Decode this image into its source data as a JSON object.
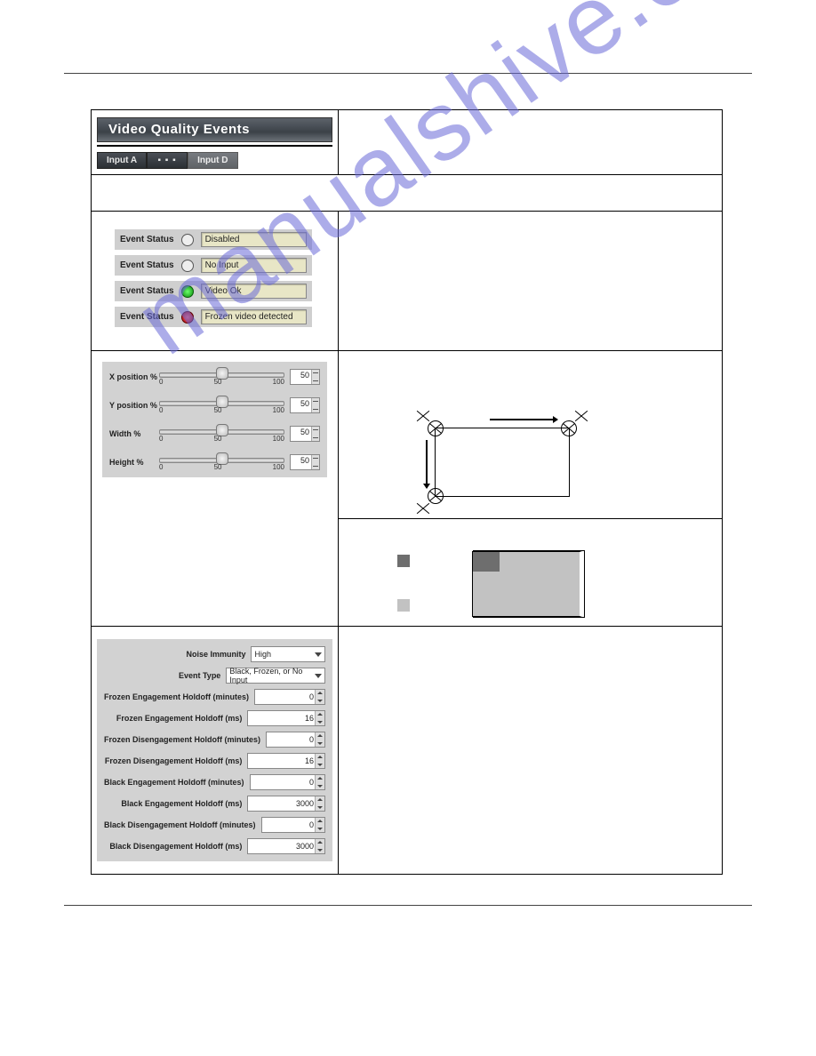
{
  "watermark": "manualshive.com",
  "header": {
    "title": "Video Quality Events",
    "tabs": {
      "a": "Input A",
      "dots": "▪ ▪ ▪",
      "d": "Input D"
    }
  },
  "statuses": [
    {
      "label": "Event Status",
      "color": "blank",
      "value": "Disabled"
    },
    {
      "label": "Event Status",
      "color": "blank",
      "value": "No Input"
    },
    {
      "label": "Event Status",
      "color": "green",
      "value": "Video Ok"
    },
    {
      "label": "Event Status",
      "color": "red",
      "value": "Frozen video detected"
    }
  ],
  "sliders": {
    "tick0": "0",
    "tick50": "50",
    "tick100": "100",
    "items": [
      {
        "label": "X position %",
        "value": "50",
        "pct": 50
      },
      {
        "label": "Y position %",
        "value": "50",
        "pct": 50
      },
      {
        "label": "Width %",
        "value": "50",
        "pct": 50
      },
      {
        "label": "Height %",
        "value": "50",
        "pct": 50
      }
    ]
  },
  "settings": {
    "noise_immunity": {
      "label": "Noise Immunity",
      "value": "High"
    },
    "event_type": {
      "label": "Event Type",
      "value": "Black, Frozen, or No Input"
    },
    "rows": [
      {
        "label": "Frozen Engagement Holdoff (minutes)",
        "value": "0"
      },
      {
        "label": "Frozen Engagement Holdoff (ms)",
        "value": "16"
      },
      {
        "label": "Frozen Disengagement Holdoff (minutes)",
        "value": "0"
      },
      {
        "label": "Frozen Disengagement Holdoff (ms)",
        "value": "16"
      },
      {
        "label": "Black Engagement Holdoff (minutes)",
        "value": "0"
      },
      {
        "label": "Black Engagement Holdoff (ms)",
        "value": "3000"
      },
      {
        "label": "Black Disengagement Holdoff (minutes)",
        "value": "0"
      },
      {
        "label": "Black Disengagement Holdoff (ms)",
        "value": "3000"
      }
    ]
  }
}
